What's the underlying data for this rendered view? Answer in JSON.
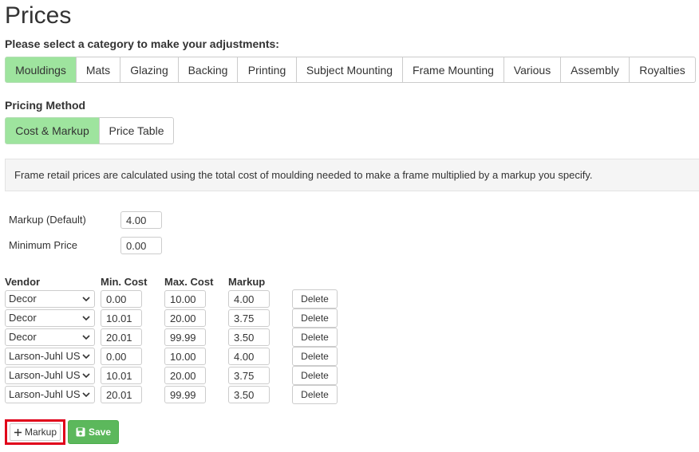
{
  "page_title": "Prices",
  "instruction": "Please select a category to make your adjustments:",
  "categories": {
    "active": "Mouldings",
    "items": [
      "Mouldings",
      "Mats",
      "Glazing",
      "Backing",
      "Printing",
      "Subject Mounting",
      "Frame Mounting",
      "Various",
      "Assembly",
      "Royalties"
    ]
  },
  "pricing_method": {
    "label": "Pricing Method",
    "active": "Cost & Markup",
    "options": [
      "Cost & Markup",
      "Price Table"
    ]
  },
  "info_text": "Frame retail prices are calculated using the total cost of moulding needed to make a frame multiplied by a markup you specify.",
  "defaults": {
    "markup_label": "Markup (Default)",
    "markup_value": "4.00",
    "min_price_label": "Minimum Price",
    "min_price_value": "0.00"
  },
  "table": {
    "headers": {
      "vendor": "Vendor",
      "min_cost": "Min. Cost",
      "max_cost": "Max. Cost",
      "markup": "Markup"
    },
    "delete_label": "Delete",
    "rows": [
      {
        "vendor": "Decor",
        "min": "0.00",
        "max": "10.00",
        "markup": "4.00"
      },
      {
        "vendor": "Decor",
        "min": "10.01",
        "max": "20.00",
        "markup": "3.75"
      },
      {
        "vendor": "Decor",
        "min": "20.01",
        "max": "99.99",
        "markup": "3.50"
      },
      {
        "vendor": "Larson-Juhl US",
        "min": "0.00",
        "max": "10.00",
        "markup": "4.00"
      },
      {
        "vendor": "Larson-Juhl US",
        "min": "10.01",
        "max": "20.00",
        "markup": "3.75"
      },
      {
        "vendor": "Larson-Juhl US",
        "min": "20.01",
        "max": "99.99",
        "markup": "3.50"
      }
    ]
  },
  "actions": {
    "add_markup_label": "Markup",
    "add_icon": "plus-icon",
    "save_label": "Save",
    "save_icon": "floppy-disk-icon"
  },
  "colors": {
    "active_tab": "#9ee49e",
    "save_button": "#5cb85c",
    "highlight_border": "#e0001a"
  }
}
